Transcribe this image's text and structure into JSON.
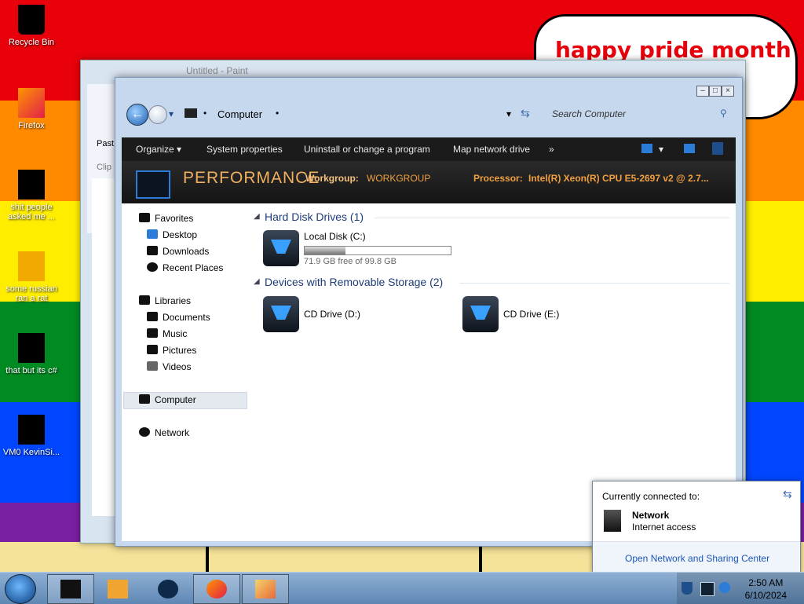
{
  "desktop": {
    "banner_text": "happy pride month",
    "icons": [
      {
        "label": "Recycle Bin",
        "icon": "recycle-bin-icon"
      },
      {
        "label": "Firefox",
        "icon": "firefox-icon"
      },
      {
        "label": "shit people asked me ...",
        "icon": "folder-icon"
      },
      {
        "label": "some russian ran a rat",
        "icon": "app-icon"
      },
      {
        "label": "that but its c#",
        "icon": "documents-icon"
      },
      {
        "label": "VM0 KevinSi...",
        "icon": "app-icon"
      }
    ]
  },
  "paint": {
    "title": "Untitled - Paint",
    "ribbon_paste": "Past",
    "ribbon_clipboard": "Clip"
  },
  "explorer": {
    "breadcrumb": "Computer",
    "search_placeholder": "Search Computer",
    "toolbar": {
      "organize": "Organize",
      "system_properties": "System properties",
      "uninstall": "Uninstall or change a program",
      "map_drive": "Map network drive",
      "more": "»"
    },
    "banner": {
      "name": "PERFORMANCE",
      "workgroup_label": "Workgroup:",
      "workgroup_value": "WORKGROUP",
      "processor_label": "Processor:",
      "processor_value": "Intel(R) Xeon(R) CPU E5-2697 v2 @ 2.7..."
    },
    "nav": {
      "favorites": "Favorites",
      "desktop": "Desktop",
      "downloads": "Downloads",
      "recent": "Recent Places",
      "libraries": "Libraries",
      "documents": "Documents",
      "music": "Music",
      "pictures": "Pictures",
      "videos": "Videos",
      "computer": "Computer",
      "network": "Network"
    },
    "hdd_group": "Hard Disk Drives (1)",
    "removable_group": "Devices with Removable Storage (2)",
    "drives": {
      "c": {
        "name": "Local Disk (C:)",
        "free": "71.9 GB free of 99.8 GB",
        "used_fraction": 0.28
      },
      "d": {
        "name": "CD Drive (D:)"
      },
      "e": {
        "name": "CD Drive (E:)"
      }
    }
  },
  "network_flyout": {
    "heading": "Currently connected to:",
    "network_name": "Network",
    "status": "Internet access",
    "link": "Open Network and Sharing Center"
  },
  "taskbar": {
    "time": "2:50 AM",
    "date": "6/10/2024"
  }
}
